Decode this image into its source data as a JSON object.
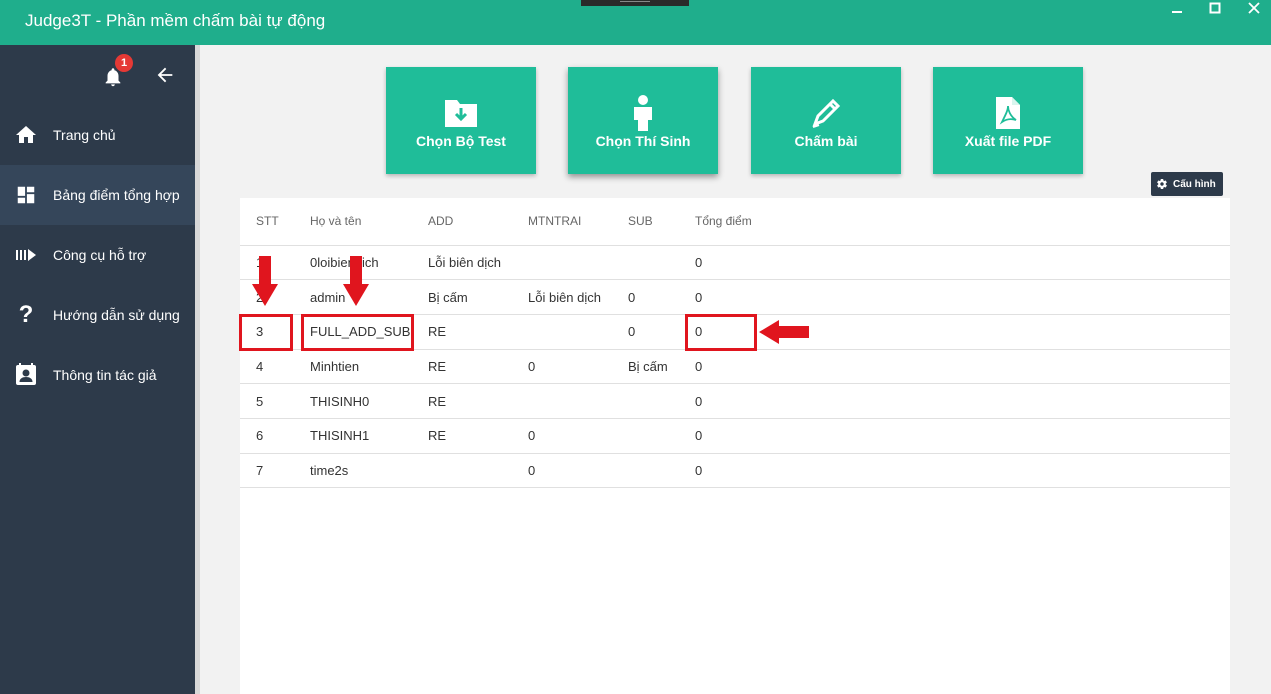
{
  "app": {
    "title": "Judge3T - Phần mềm chấm bài tự động"
  },
  "window_controls": [
    "minimize",
    "maximize",
    "close"
  ],
  "sidebar": {
    "notification_count": "1",
    "items": [
      {
        "label": "Trang chủ",
        "icon": "home-icon"
      },
      {
        "label": "Bảng điểm tổng hợp",
        "icon": "dashboard-icon"
      },
      {
        "label": "Công cụ hỗ trợ",
        "icon": "tools-icon"
      },
      {
        "label": "Hướng dẫn sử dụng",
        "icon": "help-icon"
      },
      {
        "label": "Thông tin tác giả",
        "icon": "contact-icon"
      }
    ]
  },
  "actions": [
    {
      "label": "Chọn Bộ Test",
      "icon": "folder-download-icon"
    },
    {
      "label": "Chọn Thí Sinh",
      "icon": "person-icon"
    },
    {
      "label": "Chấm bài",
      "icon": "pen-icon"
    },
    {
      "label": "Xuất file PDF",
      "icon": "pdf-file-icon"
    }
  ],
  "config_button": {
    "label": "Cấu hình"
  },
  "table": {
    "headers": [
      "STT",
      "Họ và tên",
      "ADD",
      "MTNTRAI",
      "SUB",
      "Tổng điểm"
    ],
    "rows": [
      [
        "1",
        "0loibiendich",
        "Lỗi biên dịch",
        "",
        "",
        "0"
      ],
      [
        "2",
        "admin",
        "Bị cấm",
        "Lỗi biên dịch",
        "0",
        "0"
      ],
      [
        "3",
        "FULL_ADD_SUB",
        "RE",
        "",
        "0",
        "0"
      ],
      [
        "4",
        "Minhtien",
        "RE",
        "0",
        "Bị cấm",
        "0"
      ],
      [
        "5",
        "THISINH0",
        "RE",
        "",
        "",
        "0"
      ],
      [
        "6",
        "THISINH1",
        "RE",
        "0",
        "",
        "0"
      ],
      [
        "7",
        "time2s",
        "",
        "0",
        "",
        "0"
      ]
    ]
  },
  "colors": {
    "accent": "#1fae8c",
    "button": "#1fbd99",
    "sidebar": "#2d3a4a",
    "annotation": "#e0151e"
  }
}
